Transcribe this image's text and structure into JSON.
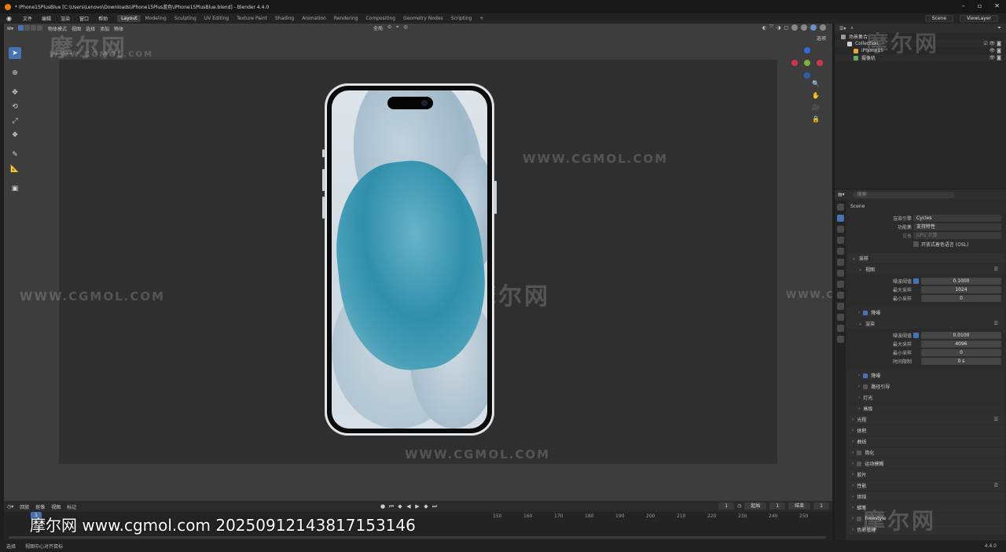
{
  "titlebar": {
    "title": "* iPhone15PlusBlue [C:\\Users\\Lenovo\\Downloads\\iPhone15Plus蓝色\\iPhone15PlusBlue.blend] - Blender 4.4.0"
  },
  "menu": {
    "items": [
      "文件",
      "编辑",
      "渲染",
      "窗口",
      "帮助"
    ]
  },
  "workspaces": [
    "Layout",
    "Modeling",
    "Sculpting",
    "UV Editing",
    "Texture Paint",
    "Shading",
    "Animation",
    "Rendering",
    "Compositing",
    "Geometry Nodes",
    "Scripting",
    "+"
  ],
  "scene": {
    "label": "Scene",
    "viewlayer": "ViewLayer"
  },
  "viewport": {
    "mode": "物体模式",
    "menus": [
      "视图",
      "选择",
      "添加",
      "物体"
    ],
    "transform": "全局",
    "xray_label": "选项",
    "watermarks": {
      "cn": "摩尔网",
      "en": "WWW.CGMOL.COM"
    }
  },
  "timeline": {
    "menus": [
      "回放",
      "抠像",
      "视图",
      "标记"
    ],
    "current_frame": "1",
    "start_label": "起始",
    "start": "1",
    "end_label": "结束",
    "end": "1",
    "ticks": [
      "1",
      "150",
      "160",
      "170",
      "180",
      "190",
      "200",
      "210",
      "220",
      "230",
      "240",
      "250"
    ]
  },
  "statusbar": {
    "select": "选择",
    "center": "视图中心对齐鼠标",
    "version": "4.4.0"
  },
  "outliner": {
    "title": "场景集合",
    "rows": [
      {
        "name": "Collection"
      },
      {
        "name": "iPhone15"
      },
      {
        "name": "摄像机"
      }
    ]
  },
  "properties": {
    "search_placeholder": "搜索",
    "scene": "Scene",
    "render_engine_label": "渲染引擎",
    "render_engine": "Cycles",
    "feature_label": "功能集",
    "feature": "支持特性",
    "device_label": "设备",
    "device": "GPU 计算",
    "osl": "开放式着色语言 (OSL)",
    "sampling": "采样",
    "viewport_section": "视图",
    "noise_threshold_label": "噪波阈值",
    "vp_noise": "0.1000",
    "max_samples_label": "最大采样",
    "vp_max": "1024",
    "min_samples_label": "最小采样",
    "vp_min": "0",
    "denoise_label": "降噪",
    "render_section": "渲染",
    "r_noise": "0.0100",
    "r_max": "4096",
    "r_min": "0",
    "time_limit_label": "时间限制",
    "r_time": "0 s",
    "path_guiding": "路径引导",
    "lights": "灯光",
    "advanced": "高级",
    "panels": [
      "光程",
      "体积",
      "曲线",
      "简化",
      "运动模糊",
      "胶片",
      "性能",
      "烘焙",
      "蜡笔",
      "Freestyle",
      "色彩管理"
    ]
  },
  "overlay_watermark": "摩尔网 www.cgmol.com 20250912143817153146"
}
